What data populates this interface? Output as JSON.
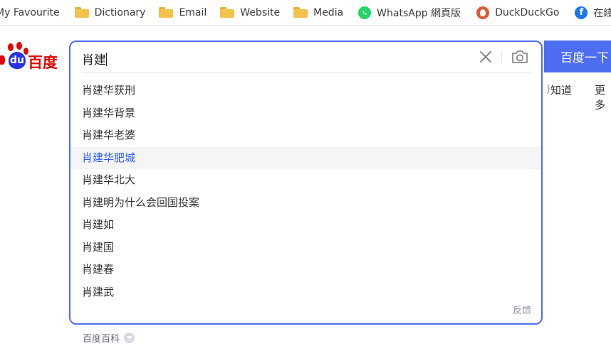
{
  "bookmarks": [
    {
      "label": "My Favourite",
      "icon": "folder-icon"
    },
    {
      "label": "Dictionary",
      "icon": "folder-icon"
    },
    {
      "label": "Email",
      "icon": "folder-icon"
    },
    {
      "label": "Website",
      "icon": "folder-icon"
    },
    {
      "label": "Media",
      "icon": "folder-icon"
    },
    {
      "label": "WhatsApp 網頁版",
      "icon": "whatsapp-icon"
    },
    {
      "label": "DuckDuckGo",
      "icon": "duckduckgo-icon"
    },
    {
      "label": "在綫",
      "icon": "facebook-icon"
    }
  ],
  "logo": {
    "du": "du",
    "text": "百度"
  },
  "search": {
    "query": "肖建",
    "suggestions": [
      "肖建华获刑",
      "肖建华背景",
      "肖建华老婆",
      "肖建华肥城",
      "肖建华北大",
      "肖建明为什么会回国投案",
      "肖建如",
      "肖建国",
      "肖建春",
      "肖建武"
    ],
    "active_index": 3,
    "feedback": "反馈",
    "button_label": "百度一下"
  },
  "nav_right": {
    "zhidao": "知道",
    "more": "更多"
  },
  "baike_label": "百度百科",
  "colors": {
    "accent": "#4e6ef2",
    "highlight": "#315efb",
    "logo_red": "#e10601",
    "logo_blue": "#2932e1"
  }
}
